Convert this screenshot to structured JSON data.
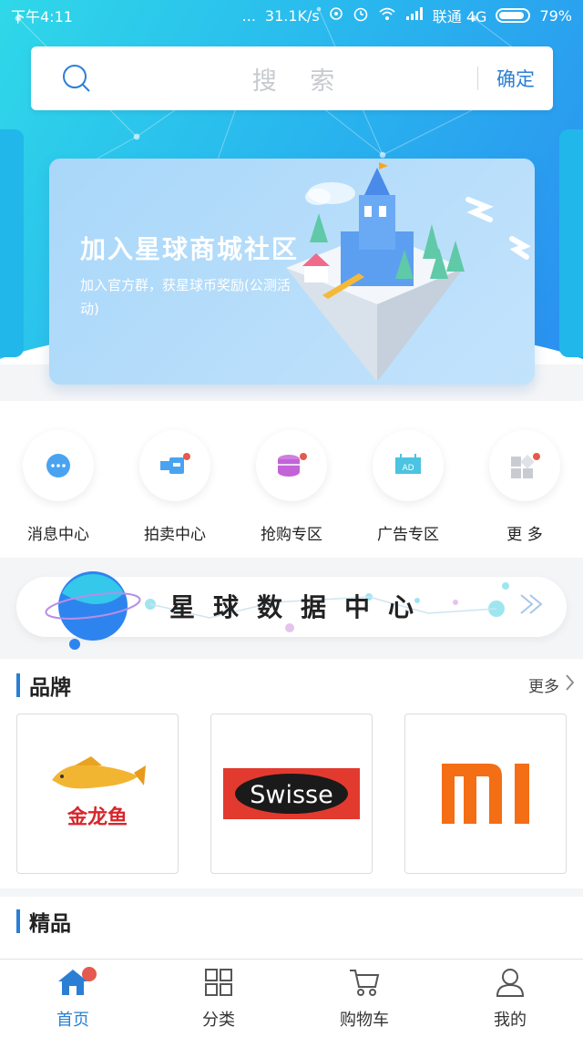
{
  "status_bar": {
    "time": "下午4:11",
    "dots": "...",
    "speed": "31.1K/s",
    "carrier": "联通 4G",
    "battery": "79%"
  },
  "search": {
    "placeholder": "搜 索",
    "confirm_label": "确定"
  },
  "banner": {
    "title": "加入星球商城社区",
    "subtitle": "加入官方群，获星球币奖励(公测活动)"
  },
  "quick_menu": [
    {
      "label": "消息中心",
      "icon": "message-icon"
    },
    {
      "label": "拍卖中心",
      "icon": "auction-icon"
    },
    {
      "label": "抢购专区",
      "icon": "flash-sale-icon"
    },
    {
      "label": "广告专区",
      "icon": "ad-icon"
    },
    {
      "label": "更 多",
      "icon": "more-grid-icon"
    }
  ],
  "data_center": {
    "title": "星球数据中心"
  },
  "brands": {
    "title": "品牌",
    "more_label": "更多",
    "items": [
      {
        "name": "金龙鱼"
      },
      {
        "name": "Swisse"
      },
      {
        "name": "mi"
      }
    ]
  },
  "fine_goods": {
    "title": "精品"
  },
  "tab_bar": [
    {
      "label": "首页",
      "icon": "home-icon",
      "active": true
    },
    {
      "label": "分类",
      "icon": "category-icon",
      "active": false
    },
    {
      "label": "购物车",
      "icon": "cart-icon",
      "active": false
    },
    {
      "label": "我的",
      "icon": "user-icon",
      "active": false
    }
  ],
  "colors": {
    "accent": "#2a7fd4",
    "header_gradient_start": "#2fd8e8",
    "header_gradient_end": "#2a8ef0",
    "badge": "#e55a4e"
  }
}
